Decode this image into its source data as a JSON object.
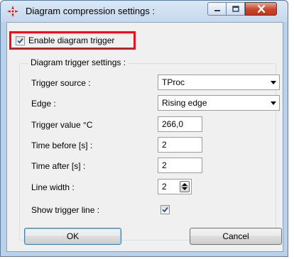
{
  "window": {
    "title": "Diagram compression settings :",
    "icon": "crosshair-target-icon",
    "accent_color": "#e0141e"
  },
  "enable_trigger": {
    "label": "Enable diagram trigger",
    "checked": true
  },
  "group": {
    "legend": "Diagram trigger settings :",
    "trigger_source": {
      "label": "Trigger source :",
      "value": "TProc"
    },
    "edge": {
      "label": "Edge :",
      "value": "Rising edge"
    },
    "trigger_value": {
      "label": "Trigger value °C",
      "value": "266,0"
    },
    "time_before": {
      "label": "Time before [s] :",
      "value": "2"
    },
    "time_after": {
      "label": "Time after [s] :",
      "value": "2"
    },
    "line_width": {
      "label": "Line width :",
      "value": "2"
    },
    "show_trigger_line": {
      "label": "Show trigger line :",
      "checked": true
    }
  },
  "buttons": {
    "ok": "OK",
    "cancel": "Cancel"
  }
}
